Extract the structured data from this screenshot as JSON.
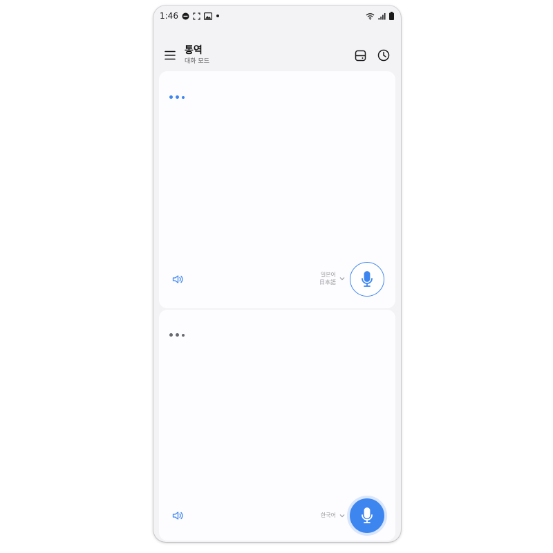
{
  "status_bar": {
    "time": "1:46"
  },
  "header": {
    "title": "통역",
    "subtitle": "대화 모드",
    "icons": [
      "menu-icon",
      "split-view-icon",
      "history-icon"
    ]
  },
  "colors": {
    "accent": "#3d86f0",
    "dots_inactive": "#666a70",
    "background": "#f3f3f6",
    "panel": "#fdfdff"
  },
  "top_panel": {
    "lang_primary": "일본어",
    "lang_secondary": "日本語",
    "mic_style": "outline"
  },
  "bottom_panel": {
    "lang_primary": "한국어",
    "mic_style": "filled"
  }
}
